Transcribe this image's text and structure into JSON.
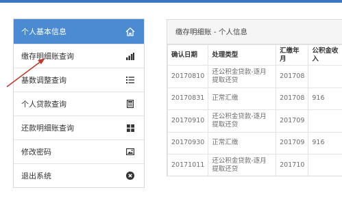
{
  "sidebar": {
    "items": [
      {
        "label": "个人基本信息",
        "icon": "home-icon",
        "active": true
      },
      {
        "label": "缴存明细账查询",
        "icon": "bar-chart-icon"
      },
      {
        "label": "基数调整查询",
        "icon": "list-icon"
      },
      {
        "label": "个人贷款查询",
        "icon": "calculator-icon"
      },
      {
        "label": "还款明细账查询",
        "icon": "grid-icon"
      },
      {
        "label": "修改密码",
        "icon": "image-icon"
      },
      {
        "label": "退出系统",
        "icon": "close-circle-icon"
      }
    ]
  },
  "panel": {
    "title": "缴存明细账 - 个人信息",
    "columns": [
      "确认日期",
      "处理类型",
      "汇缴年月",
      "公积金收入"
    ],
    "rows": [
      [
        "20170810",
        "还公积金贷款-逐月提取还贷",
        "201708",
        ""
      ],
      [
        "20170831",
        "正常汇缴",
        "201708",
        "916"
      ],
      [
        "20170910",
        "还公积金贷款-逐月提取还贷",
        "201709",
        ""
      ],
      [
        "20170930",
        "正常汇缴",
        "201709",
        "916"
      ],
      [
        "20171011",
        "还公积金贷款-逐月提取还贷",
        "201710",
        ""
      ]
    ]
  },
  "colors": {
    "accent": "#4a8bd1",
    "annotation_arrow": "#c0392b"
  }
}
